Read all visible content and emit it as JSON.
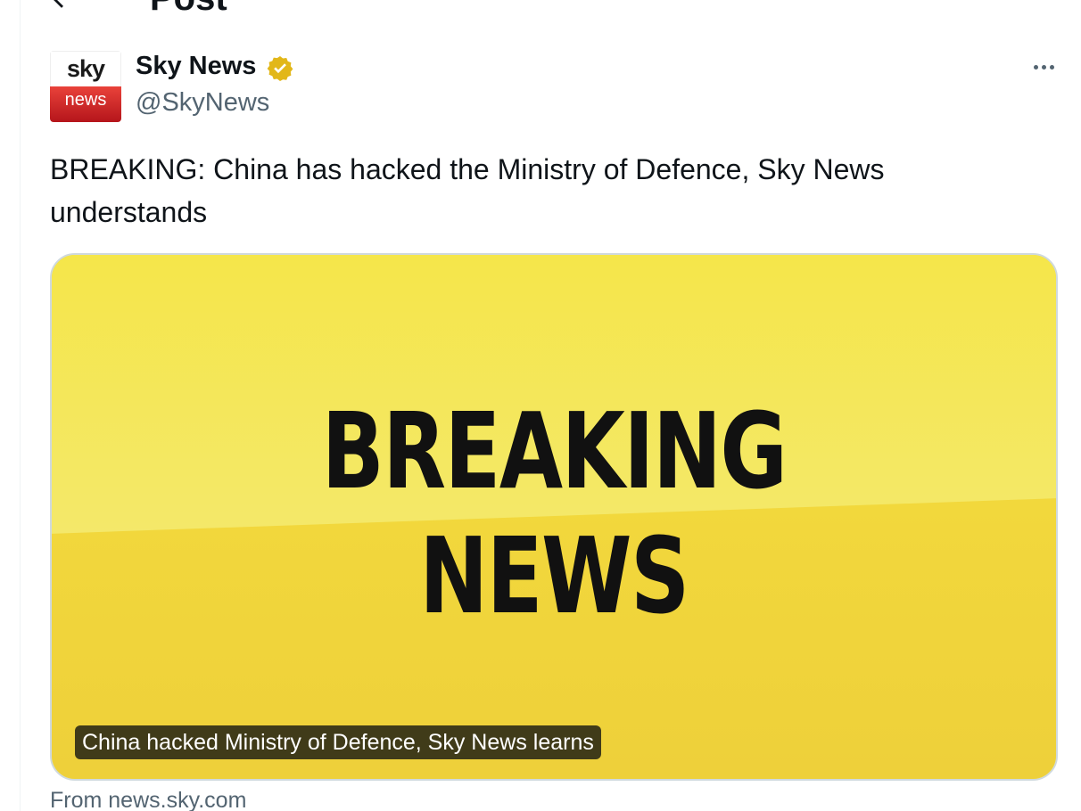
{
  "header": {
    "title": "Post"
  },
  "author": {
    "name": "Sky News",
    "handle": "@SkyNews",
    "avatar_top": "sky",
    "avatar_bottom": "news",
    "verified_color": "#e2b719"
  },
  "tweet": {
    "text": "BREAKING: China has hacked the Ministry of Defence, Sky News understands"
  },
  "card": {
    "image_line1": "BREAKING",
    "image_line2": "NEWS",
    "caption": "China hacked Ministry of Defence, Sky News learns",
    "source": "From news.sky.com",
    "background_color": "#f1d63a"
  },
  "icons": {
    "back": "arrow-left-icon",
    "more": "more-dots-icon",
    "verified": "verified-badge-icon"
  }
}
